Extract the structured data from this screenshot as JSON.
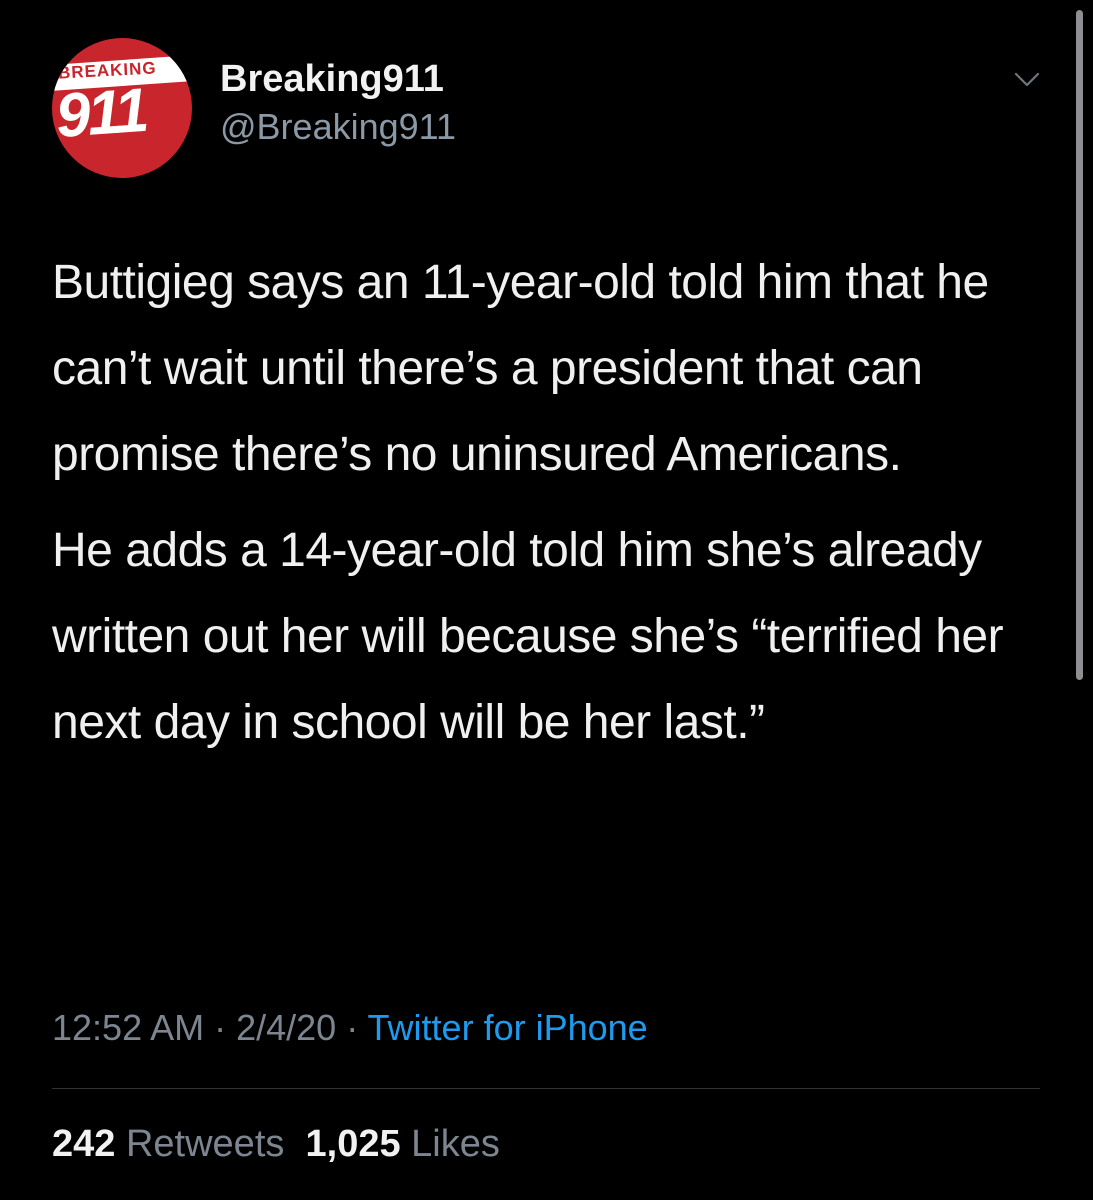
{
  "author": {
    "display_name": "Breaking911",
    "handle": "@Breaking911",
    "avatar": {
      "top_text": "BREAKING",
      "main_text": "911",
      "brand_color": "#c9252c"
    }
  },
  "tweet": {
    "paragraphs": [
      "Buttigieg says an 11-year-old told him that he can’t wait until there’s a president that can promise there’s no uninsured Americans.",
      "He adds a 14-year-old told him she’s already written out her will because she’s “terrified her next day in school will be her last.”"
    ],
    "time": "12:52 AM",
    "separator": " · ",
    "date": "2/4/20",
    "source": "Twitter for iPhone"
  },
  "stats": {
    "retweets_count": "242",
    "retweets_label": "Retweets",
    "likes_count": "1,025",
    "likes_label": "Likes"
  },
  "icons": {
    "menu": "chevron-down-icon"
  },
  "colors": {
    "background": "#000000",
    "link": "#1d9bf0",
    "muted": "#7d8690"
  }
}
